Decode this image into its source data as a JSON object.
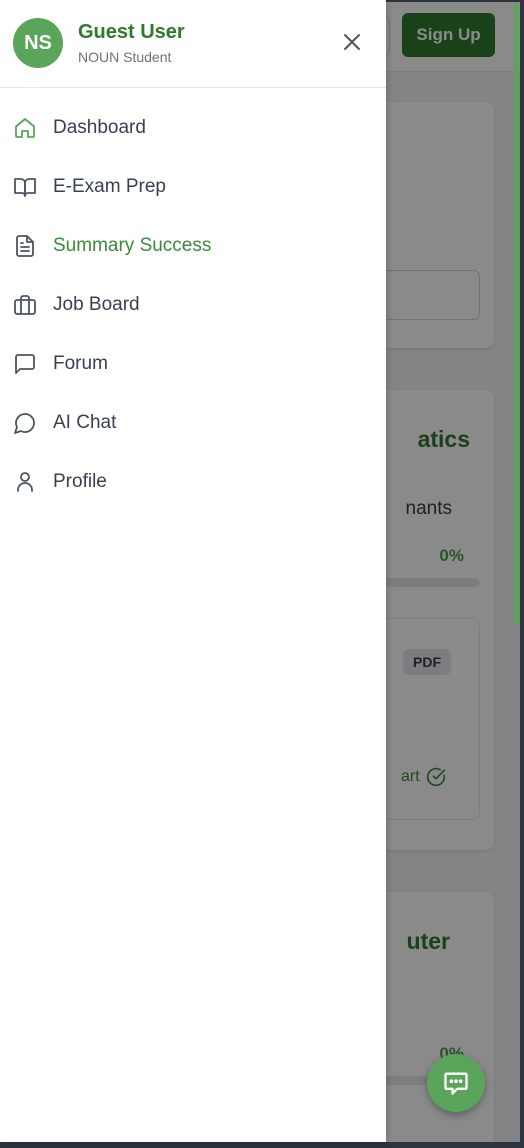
{
  "background": {
    "signup_label": "Sign Up",
    "course1": {
      "title_partial": "atics",
      "subtitle_partial": "nants",
      "progress": "0%",
      "progress_fraction": 0,
      "badge": "PDF",
      "start_partial": "art"
    },
    "course2": {
      "title_partial": "uter",
      "progress": "0%",
      "progress_fraction": 0
    }
  },
  "drawer": {
    "user": {
      "initials": "NS",
      "name": "Guest User",
      "role": "NOUN Student"
    },
    "nav_items": [
      {
        "label": "Dashboard",
        "icon": "home-icon",
        "active": false
      },
      {
        "label": "E-Exam Prep",
        "icon": "book-open-icon",
        "active": false
      },
      {
        "label": "Summary Success",
        "icon": "document-text-icon",
        "active": true
      },
      {
        "label": "Job Board",
        "icon": "briefcase-icon",
        "active": false
      },
      {
        "label": "Forum",
        "icon": "message-square-icon",
        "active": false
      },
      {
        "label": "AI Chat",
        "icon": "message-circle-icon",
        "active": false
      },
      {
        "label": "Profile",
        "icon": "user-icon",
        "active": false
      }
    ]
  },
  "colors": {
    "brand_green": "#2f7a2f",
    "accent_green": "#5aa55a",
    "active_nav": "#3a8a3a",
    "text": "#374151",
    "muted": "#6b7280"
  }
}
